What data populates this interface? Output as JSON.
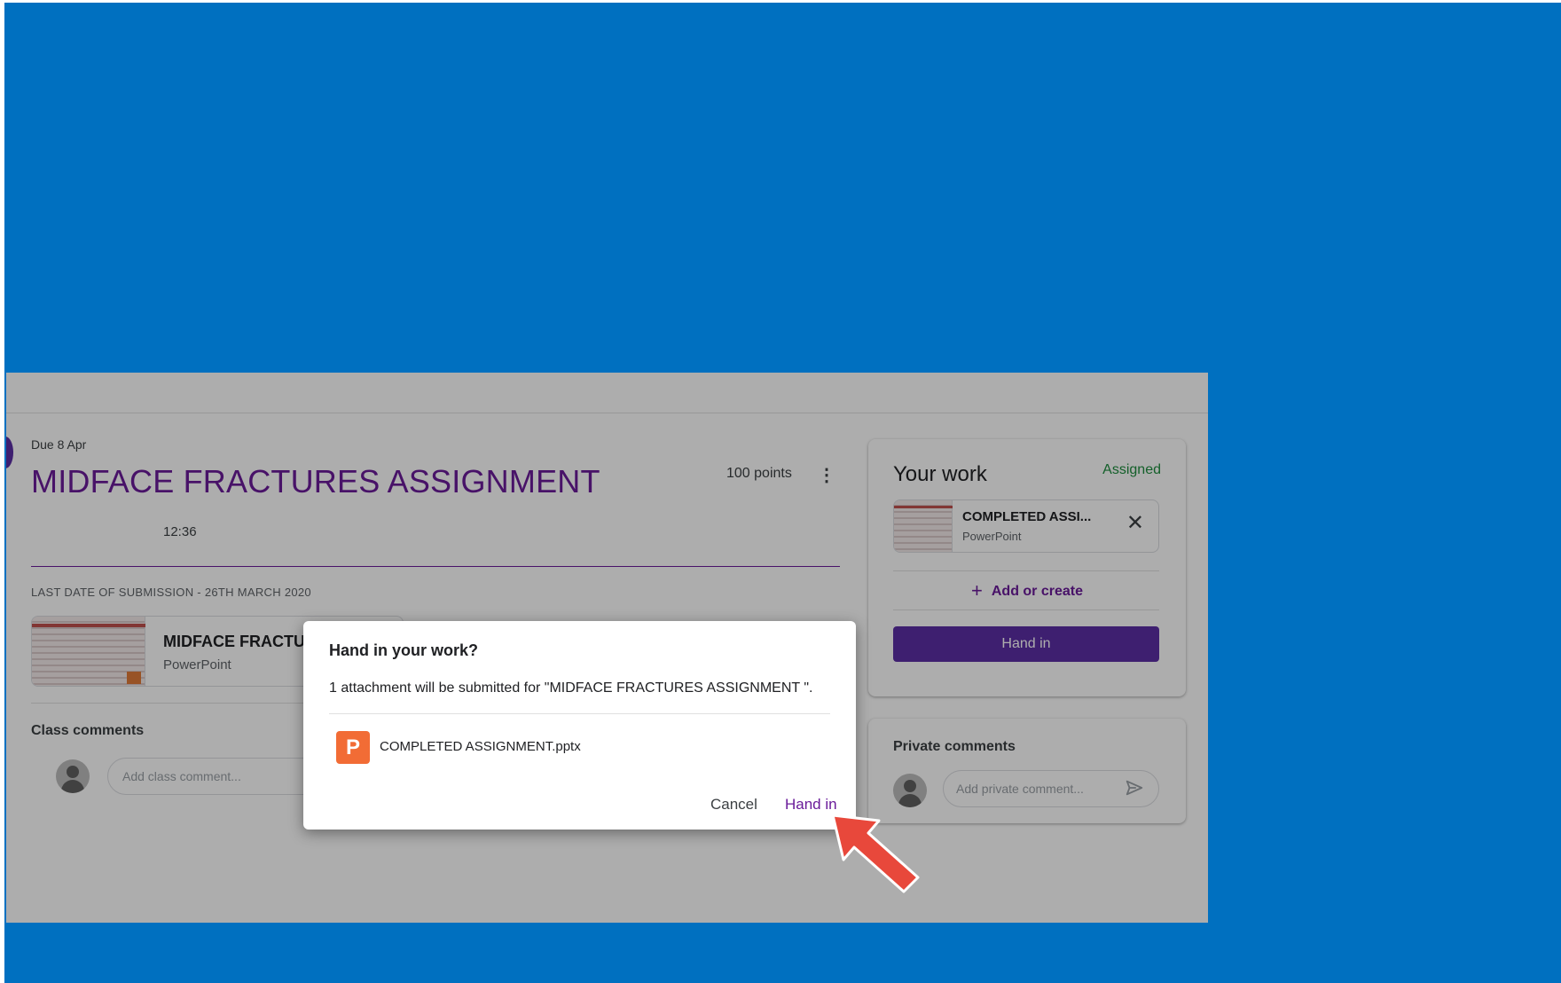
{
  "assignment": {
    "due": "Due 8 Apr",
    "title": "MIDFACE FRACTURES ASSIGNMENT",
    "points": "100 points",
    "time": "12:36",
    "last_date": "LAST DATE OF SUBMISSION - 26TH MARCH 2020",
    "attachment": {
      "name": "MIDFACE FRACTU",
      "type": "PowerPoint"
    }
  },
  "class_comments": {
    "heading": "Class comments",
    "placeholder": "Add class comment..."
  },
  "your_work": {
    "title": "Your work",
    "status": "Assigned",
    "file": {
      "name": "COMPLETED ASSI...",
      "type": "PowerPoint"
    },
    "add_label": "Add or create",
    "hand_in_label": "Hand in"
  },
  "private_comments": {
    "heading": "Private comments",
    "placeholder": "Add private comment..."
  },
  "dialog": {
    "title": "Hand in your work?",
    "message": "1 attachment will be submitted for \"MIDFACE FRACTURES ASSIGNMENT \".",
    "file_icon_letter": "P",
    "file_name": "COMPLETED ASSIGNMENT.pptx",
    "cancel_label": "Cancel",
    "hand_in_label": "Hand in"
  },
  "colors": {
    "slide_background": "#0070c0",
    "accent_purple": "#5c2ea6",
    "status_green": "#1e8e3e",
    "pointer_arrow": "#e8483b"
  },
  "icons": {
    "menu": "kebab-menu-icon",
    "remove": "close-icon",
    "add": "plus-icon",
    "send": "send-icon",
    "pointer": "red-arrow-icon"
  }
}
